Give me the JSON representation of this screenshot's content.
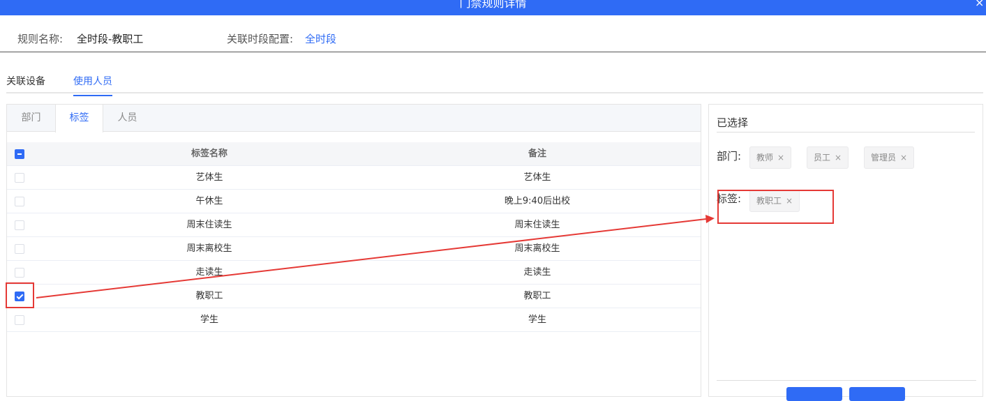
{
  "window": {
    "title": "门禁规则详情",
    "close_glyph": "×"
  },
  "info": {
    "rule_name_label": "规则名称:",
    "rule_name_value": "全时段-教职工",
    "time_config_label": "关联时段配置:",
    "time_config_value": "全时段"
  },
  "main_tabs": [
    {
      "label": "关联设备",
      "active": false
    },
    {
      "label": "使用人员",
      "active": true
    }
  ],
  "sub_tabs": [
    {
      "label": "部门",
      "active": false
    },
    {
      "label": "标签",
      "active": true
    },
    {
      "label": "人员",
      "active": false
    }
  ],
  "table": {
    "columns": [
      "标签名称",
      "备注"
    ],
    "header_checkbox": "indeterminate",
    "rows": [
      {
        "name": "艺体生",
        "remark": "艺体生",
        "checked": false
      },
      {
        "name": "午休生",
        "remark": "晚上9:40后出校",
        "checked": false
      },
      {
        "name": "周末住读生",
        "remark": "周末住读生",
        "checked": false
      },
      {
        "name": "周末离校生",
        "remark": "周末离校生",
        "checked": false
      },
      {
        "name": "走读生",
        "remark": "走读生",
        "checked": false
      },
      {
        "name": "教职工",
        "remark": "教职工",
        "checked": true
      },
      {
        "name": "学生",
        "remark": "学生",
        "checked": false
      }
    ]
  },
  "selected": {
    "title": "已选择",
    "dept_label": "部门:",
    "dept_tags": [
      "教师",
      "员工",
      "管理员"
    ],
    "tag_label": "标签:",
    "tag_tags": [
      "教职工"
    ],
    "remove_glyph": "×"
  },
  "colors": {
    "accent": "#2f6bf5",
    "annotation": "#e53935"
  }
}
